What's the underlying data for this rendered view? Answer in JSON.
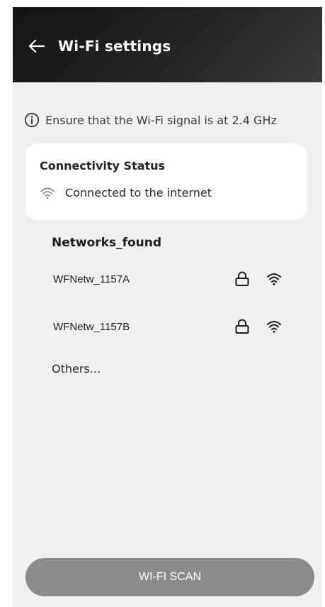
{
  "header": {
    "title": "Wi-Fi settings",
    "back_icon": "arrow-left-icon",
    "background": "#1c1c1c"
  },
  "hint": {
    "icon": "info-icon",
    "text": "Ensure that the Wi-Fi signal is at 2.4 GHz"
  },
  "status_card": {
    "title": "Connectivity Status",
    "icon": "wifi-icon",
    "status_text": "Connected to the internet"
  },
  "networks": {
    "title": "Networks_found",
    "items": [
      {
        "name": "WFNetw_1157A",
        "secured": true,
        "lock_icon": "lock-icon",
        "signal_icon": "wifi-icon"
      },
      {
        "name": "WFNetw_1157B",
        "secured": true,
        "lock_icon": "lock-icon",
        "signal_icon": "wifi-icon"
      }
    ],
    "others_label": "Others..."
  },
  "scan_button": {
    "label": "WI-FI SCAN",
    "color": "#8c8c8c"
  }
}
